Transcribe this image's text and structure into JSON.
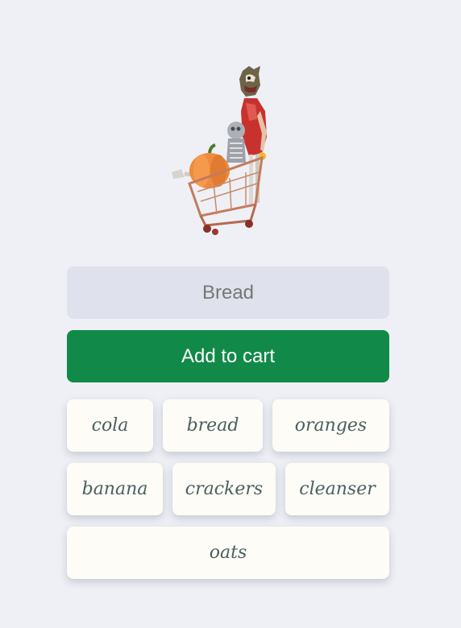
{
  "hero": {
    "icon": "skeleton-pushing-shopping-cart-with-pumpkin"
  },
  "input": {
    "placeholder": "Bread",
    "value": ""
  },
  "add_button": {
    "label": "Add to cart",
    "color": "#118a49"
  },
  "suggestions": {
    "rows": [
      [
        "cola",
        "bread",
        "oranges"
      ],
      [
        "banana",
        "crackers",
        "cleanser"
      ],
      [
        "oats"
      ]
    ]
  },
  "colors": {
    "background": "#eef0f5",
    "input_background": "#dfe2ec",
    "chip_background": "#fdfcf7",
    "chip_text": "#4b605f"
  }
}
